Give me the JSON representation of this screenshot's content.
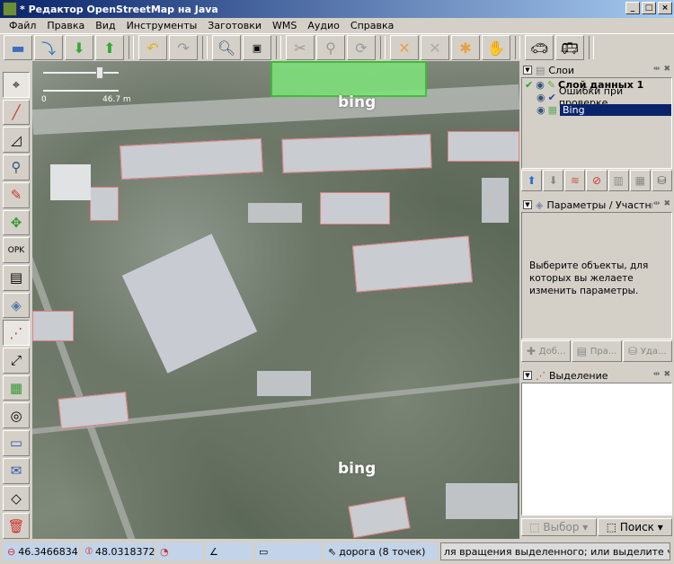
{
  "window": {
    "title": "* Редактор OpenStreetMap на Java",
    "minimize": "_",
    "maximize": "□",
    "close": "×"
  },
  "menu": [
    "Файл",
    "Правка",
    "Вид",
    "Инструменты",
    "Заготовки",
    "WMS",
    "Аудио",
    "Справка"
  ],
  "toolbar": [
    "open-icon",
    "download-icon",
    "download-green-icon",
    "upload-icon",
    "undo-icon",
    "redo-icon",
    "zoom-preview-icon",
    "preferences-icon",
    "split-way-icon",
    "combine-icon",
    "refresh-icon",
    "orthogonal-icon",
    "align-icon",
    "node-icon",
    "hand-icon",
    "car-icon",
    "bus-icon"
  ],
  "map": {
    "scale_min": "0",
    "scale_max": "46.7 m",
    "watermark": "bing",
    "zoom_level": 0.75
  },
  "layers_panel": {
    "title": "Слои",
    "layers": [
      {
        "name": "Слой данных 1",
        "bold": true,
        "active": true
      },
      {
        "name": "Ошибки при проверке"
      },
      {
        "name": "Bing",
        "selected": true
      }
    ]
  },
  "props_panel": {
    "title": "Параметры / Участники",
    "message": "Выберите объекты, для которых вы желаете изменить параметры.",
    "add": "Доб...",
    "edit": "Пра...",
    "delete": "Уда..."
  },
  "selection_panel": {
    "title": "Выделение",
    "select": "Выбор",
    "search": "Поиск"
  },
  "status": {
    "lat": "46.3466834",
    "lon": "48.0318372",
    "info": "дорога (8 точек)",
    "message": "ля вращения выделенного; или выделите что-либо другое"
  },
  "colors": {
    "selection": "#0a246a",
    "building_outline": "#e08080",
    "park": "#7ee07a"
  }
}
